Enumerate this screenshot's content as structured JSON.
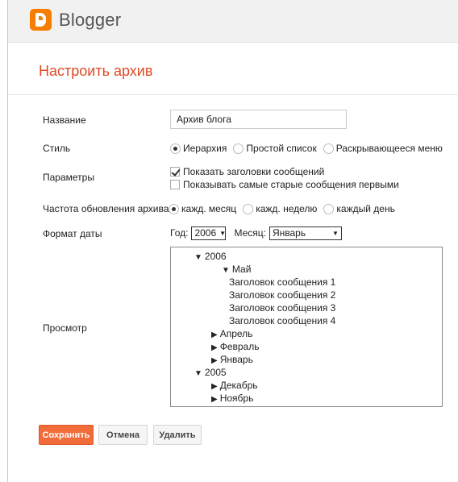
{
  "app": {
    "brand": "Blogger"
  },
  "page": {
    "title": "Настроить архив"
  },
  "form": {
    "name_label": "Название",
    "name_value": "Архив блога",
    "style_label": "Стиль",
    "style_options": [
      "Иерархия",
      "Простой список",
      "Раскрывающееся меню"
    ],
    "style_selected": "Иерархия",
    "params_label": "Параметры",
    "params": [
      {
        "label": "Показать заголовки сообщений",
        "checked": true
      },
      {
        "label": "Показывать самые старые сообщения первыми",
        "checked": false
      }
    ],
    "frequency_label": "Частота обновления архива",
    "frequency_options": [
      "кажд. месяц",
      "кажд. неделю",
      "каждый день"
    ],
    "frequency_selected": "кажд. месяц",
    "date_format_label": "Формат даты",
    "year_label": "Год:",
    "year_value": "2006",
    "month_label": "Месяц:",
    "month_value": "Январь",
    "preview_label": "Просмотр"
  },
  "preview_tree": {
    "y2006": "2006",
    "may": "Май",
    "posts": [
      "Заголовок сообщения 1",
      "Заголовок сообщения 2",
      "Заголовок сообщения 3",
      "Заголовок сообщения 4"
    ],
    "april": "Апрель",
    "february": "Февраль",
    "january": "Январь",
    "y2005": "2005",
    "december": "Декабрь",
    "november": "Ноябрь"
  },
  "buttons": {
    "save": "Сохранить",
    "cancel": "Отмена",
    "delete": "Удалить"
  },
  "colors": {
    "accent": "#dd4b25",
    "save_button": "#f26b3a",
    "logo": "#f57d00"
  }
}
